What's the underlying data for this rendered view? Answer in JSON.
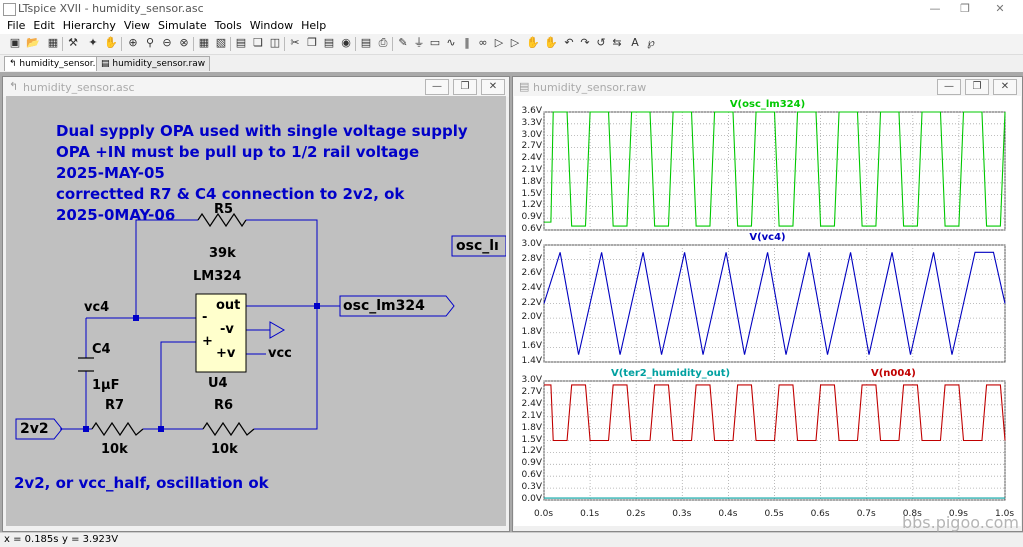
{
  "window": {
    "title": "LTspice XVII - humidity_sensor.asc"
  },
  "menu": [
    "File",
    "Edit",
    "Hierarchy",
    "View",
    "Simulate",
    "Tools",
    "Window",
    "Help"
  ],
  "tabs": [
    {
      "label": "humidity_sensor.asc"
    },
    {
      "label": "humidity_sensor.raw"
    }
  ],
  "schematic_window": {
    "title": "humidity_sensor.asc"
  },
  "plot_window": {
    "title": "humidity_sensor.raw"
  },
  "schematic": {
    "notes": [
      "Dual sypply OPA used with single voltage supply",
      "OPA +IN must be pull up to 1/2 rail voltage",
      "2025-MAY-05",
      "correctted R7 & C4 connection to 2v2, ok",
      "2025-0MAY-06"
    ],
    "bottom_note": "2v2, or vcc_half, oscillation ok",
    "labels": {
      "r5": "R5",
      "r5_val": "39k",
      "u4_model": "LM324",
      "u4": "U4",
      "out": "out",
      "minus_sign": "-",
      "minus_v": "-v",
      "plus_sign": "+",
      "plus_v": "+v",
      "vc4": "vc4",
      "c4": "C4",
      "c4_val": "1µF",
      "r7": "R7",
      "r7_val": "10k",
      "r6": "R6",
      "r6_val": "10k",
      "net_2v2": "2v2",
      "net_osc": "osc_lm324",
      "net_osc_clip": "osc_lı",
      "net_vcc": "vcc"
    }
  },
  "chart_data": [
    {
      "type": "line",
      "title": "",
      "series": [
        {
          "name": "V(osc_lm324)",
          "color": "#00c800",
          "x": [
            0.0,
            0.015,
            0.02,
            0.05,
            0.06,
            0.09,
            0.1,
            0.14,
            0.15,
            0.18,
            0.19,
            0.23,
            0.24,
            0.27,
            0.28,
            0.32,
            0.33,
            0.36,
            0.37,
            0.41,
            0.42,
            0.45,
            0.46,
            0.5,
            0.51,
            0.54,
            0.55,
            0.59,
            0.6,
            0.63,
            0.64,
            0.68,
            0.69,
            0.72,
            0.73,
            0.77,
            0.78,
            0.81,
            0.82,
            0.86,
            0.87,
            0.9,
            0.91,
            0.95,
            0.96,
            0.99,
            1.0
          ],
          "y": [
            0.8,
            0.8,
            3.6,
            3.6,
            0.7,
            0.7,
            3.6,
            3.6,
            0.7,
            0.7,
            3.6,
            3.6,
            0.7,
            0.7,
            3.6,
            3.6,
            0.7,
            0.7,
            3.6,
            3.6,
            0.7,
            0.7,
            3.6,
            3.6,
            0.7,
            0.7,
            3.6,
            3.6,
            0.7,
            0.7,
            3.6,
            3.6,
            0.7,
            0.7,
            3.6,
            3.6,
            0.7,
            0.7,
            3.6,
            3.6,
            0.7,
            0.7,
            3.6,
            3.6,
            0.7,
            0.7,
            3.6
          ]
        }
      ],
      "yticks": [
        "3.6V",
        "3.3V",
        "3.0V",
        "2.7V",
        "2.4V",
        "2.1V",
        "1.8V",
        "1.5V",
        "1.2V",
        "0.9V",
        "0.6V"
      ],
      "ylim": [
        0.6,
        3.6
      ]
    },
    {
      "type": "line",
      "title": "",
      "series": [
        {
          "name": "V(vc4)",
          "color": "#0000c0",
          "x": [
            0.0,
            0.035,
            0.075,
            0.125,
            0.165,
            0.215,
            0.255,
            0.305,
            0.345,
            0.395,
            0.435,
            0.485,
            0.525,
            0.575,
            0.615,
            0.665,
            0.705,
            0.755,
            0.795,
            0.845,
            0.885,
            0.935,
            0.975,
            1.0
          ],
          "y": [
            2.2,
            2.9,
            1.5,
            2.9,
            1.5,
            2.9,
            1.5,
            2.9,
            1.5,
            2.9,
            1.5,
            2.9,
            1.5,
            2.9,
            1.5,
            2.9,
            1.5,
            2.9,
            1.5,
            2.9,
            1.5,
            2.9,
            2.9,
            2.2
          ]
        }
      ],
      "yticks": [
        "3.0V",
        "2.8V",
        "2.6V",
        "2.4V",
        "2.2V",
        "2.0V",
        "1.8V",
        "1.6V",
        "1.4V"
      ],
      "ylim": [
        1.4,
        3.0
      ]
    },
    {
      "type": "line",
      "title": "",
      "series": [
        {
          "name": "V(ter2_humidity_out)",
          "color": "#00a0a0",
          "x": [
            0.0,
            1.0
          ],
          "y": [
            0.05,
            0.05
          ]
        },
        {
          "name": "V(n004)",
          "color": "#c00000",
          "x": [
            0.0,
            0.015,
            0.02,
            0.05,
            0.06,
            0.09,
            0.1,
            0.14,
            0.15,
            0.18,
            0.19,
            0.23,
            0.24,
            0.27,
            0.28,
            0.32,
            0.33,
            0.36,
            0.37,
            0.41,
            0.42,
            0.45,
            0.46,
            0.5,
            0.51,
            0.54,
            0.55,
            0.59,
            0.6,
            0.63,
            0.64,
            0.68,
            0.69,
            0.72,
            0.73,
            0.77,
            0.78,
            0.81,
            0.82,
            0.86,
            0.87,
            0.9,
            0.91,
            0.95,
            0.96,
            0.99,
            1.0
          ],
          "y": [
            2.9,
            2.9,
            1.5,
            1.5,
            2.9,
            2.9,
            1.5,
            1.5,
            2.9,
            2.9,
            1.5,
            1.5,
            2.9,
            2.9,
            1.5,
            1.5,
            2.9,
            2.9,
            1.5,
            1.5,
            2.9,
            2.9,
            1.5,
            1.5,
            2.9,
            2.9,
            1.5,
            1.5,
            2.9,
            2.9,
            1.5,
            1.5,
            2.9,
            2.9,
            1.5,
            1.5,
            2.9,
            2.9,
            1.5,
            1.5,
            2.9,
            2.9,
            1.5,
            1.5,
            2.9,
            2.9,
            1.5
          ]
        }
      ],
      "yticks": [
        "3.0V",
        "2.7V",
        "2.4V",
        "2.1V",
        "1.8V",
        "1.5V",
        "1.2V",
        "0.9V",
        "0.6V",
        "0.3V",
        "0.0V"
      ],
      "ylim": [
        0.0,
        3.0
      ]
    }
  ],
  "xaxis": {
    "ticks": [
      "0.0s",
      "0.1s",
      "0.2s",
      "0.3s",
      "0.4s",
      "0.5s",
      "0.6s",
      "0.7s",
      "0.8s",
      "0.9s",
      "1.0s"
    ],
    "xlim": [
      0,
      1
    ]
  },
  "status": {
    "x": "x = 0.185s",
    "y": "y = 3.923V"
  },
  "watermark": "bbs.pigoo.com"
}
